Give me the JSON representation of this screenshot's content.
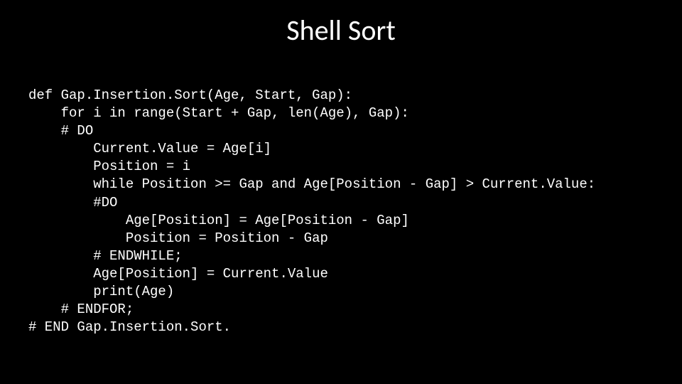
{
  "title": "Shell Sort",
  "code": {
    "l01": "def Gap.Insertion.Sort(Age, Start, Gap):",
    "l02": "    for i in range(Start + Gap, len(Age), Gap):",
    "l03": "    # DO",
    "l04": "        Current.Value = Age[i]",
    "l05": "        Position = i",
    "l06": "        while Position >= Gap and Age[Position - Gap] > Current.Value:",
    "l07": "        #DO",
    "l08": "            Age[Position] = Age[Position - Gap]",
    "l09": "            Position = Position - Gap",
    "l10": "        # ENDWHILE;",
    "l11": "        Age[Position] = Current.Value",
    "l12": "        print(Age)",
    "l13": "    # ENDFOR;",
    "l14": "# END Gap.Insertion.Sort."
  }
}
